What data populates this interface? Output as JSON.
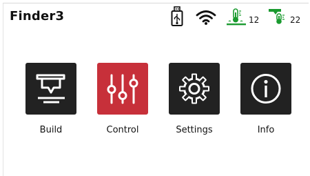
{
  "header": {
    "title": "Finder3",
    "nozzle_temp": "12",
    "bed_temp": "22",
    "icons": [
      "usb-drive-icon",
      "wifi-icon",
      "bed-temperature-icon",
      "nozzle-temperature-icon"
    ],
    "colors": {
      "temp_green": "#1a9a2f"
    }
  },
  "menu": [
    {
      "label": "Build",
      "icon": "build-icon",
      "tile_color": "#222222"
    },
    {
      "label": "Control",
      "icon": "sliders-icon",
      "tile_color": "#c7303a"
    },
    {
      "label": "Settings",
      "icon": "gear-icon",
      "tile_color": "#222222"
    },
    {
      "label": "Info",
      "icon": "info-icon",
      "tile_color": "#222222"
    }
  ]
}
